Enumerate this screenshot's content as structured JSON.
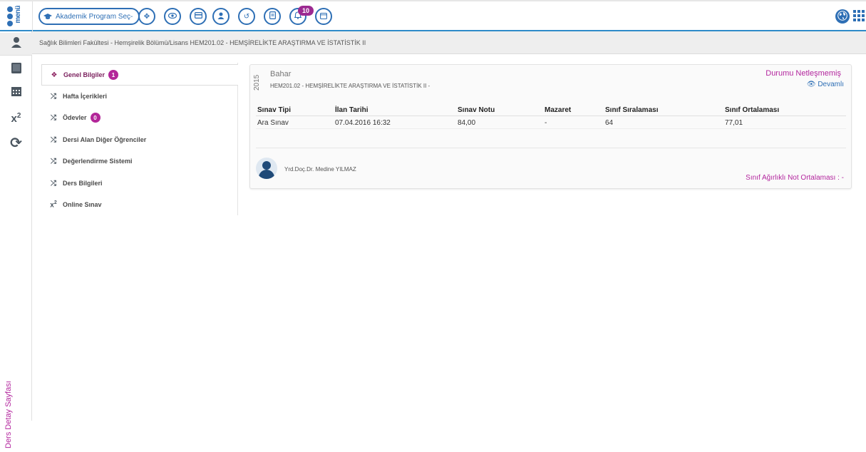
{
  "topbar": {
    "logo_text": "menü",
    "program_select_label": "Akademik Program Seç-",
    "notification_count": "10"
  },
  "sidebar": {
    "vertical_label": "Ders Detay Sayfası"
  },
  "breadcrumb": {
    "text": "Sağlık Bilimleri Fakültesi - Hemşirelik Bölümü/Lisans HEM201.02 - HEMŞİRELİKTE ARAŞTIRMA VE İSTATİSTİK II"
  },
  "course_menu": {
    "items": [
      {
        "label": "Genel Bilgiler",
        "badge": "1",
        "icon": "dropbox-icon"
      },
      {
        "label": "Hafta İçerikleri",
        "icon": "shuffle-icon"
      },
      {
        "label": "Ödevler",
        "badge": "0",
        "icon": "shuffle-icon"
      },
      {
        "label": "Dersi Alan Diğer Öğrenciler",
        "icon": "shuffle-icon"
      },
      {
        "label": "Değerlendirme Sistemi",
        "icon": "shuffle-icon"
      },
      {
        "label": "Ders Bilgileri",
        "icon": "shuffle-icon"
      },
      {
        "label": "Online Sınav",
        "icon": "superscript-icon"
      }
    ]
  },
  "card": {
    "year": "2015",
    "term": "Bahar",
    "course": "HEM201.02 - HEMŞİRELİKTE ARAŞTIRMA VE İSTATİSTİK II -",
    "status": "Durumu Netleşmemiş",
    "details_link": "Devamlı",
    "columns": [
      "Sınav Tipi",
      "İlan Tarihi",
      "Sınav Notu",
      "Mazaret",
      "Sınıf Sıralaması",
      "Sınıf Ortalaması"
    ],
    "rows": [
      [
        "Ara Sınav",
        "07.04.2016 16:32",
        "84,00",
        "-",
        "64",
        "77,01"
      ]
    ],
    "teacher": "Yrd.Doç.Dr. Medine YILMAZ",
    "weighted_avg": "Sınıf Ağırlıklı Not Ortalaması : -"
  },
  "colors": {
    "brand_blue": "#2e6fb5",
    "accent_magenta": "#b3269e"
  }
}
